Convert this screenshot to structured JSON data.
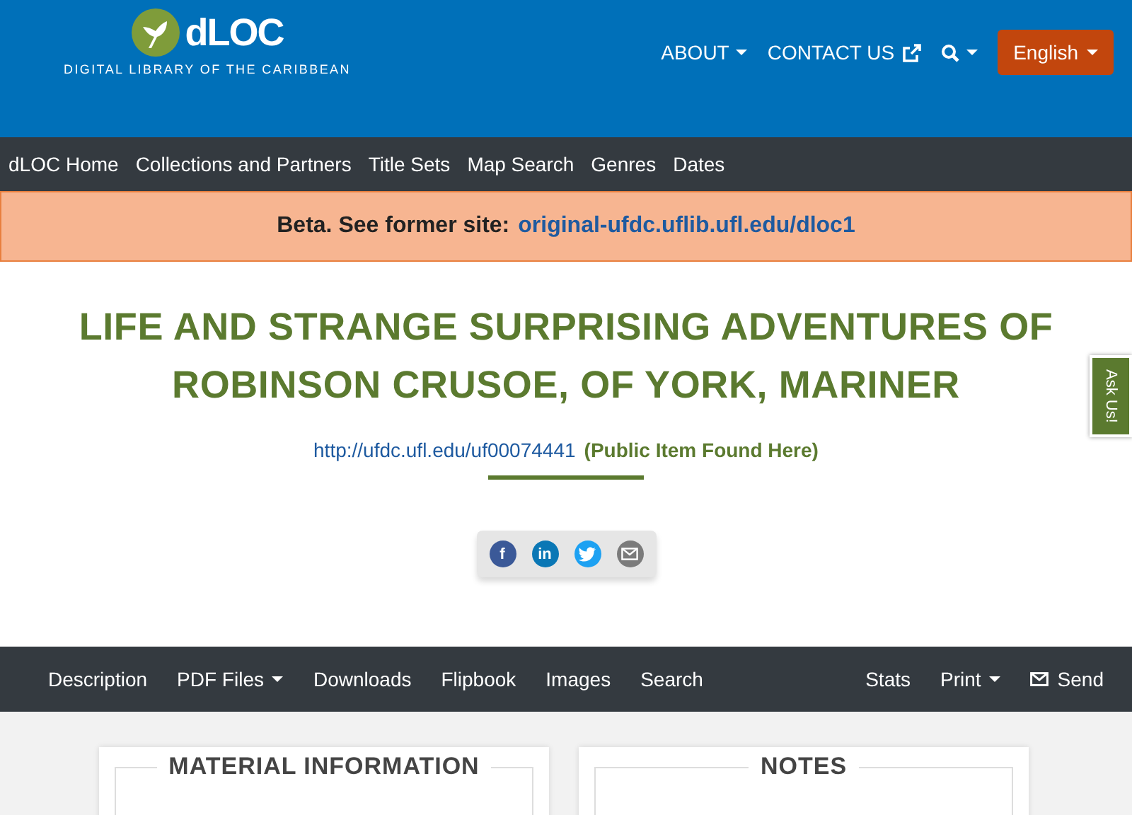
{
  "header": {
    "logo": {
      "name": "dLOC",
      "tagline": "DIGITAL LIBRARY OF THE CARIBBEAN"
    },
    "menu": [
      {
        "kind": "dropdown",
        "label": "ABOUT"
      },
      {
        "kind": "external",
        "label": "CONTACT US"
      },
      {
        "kind": "search"
      }
    ],
    "language": "English"
  },
  "main_nav": [
    "dLOC Home",
    "Collections and Partners",
    "Title Sets",
    "Map Search",
    "Genres",
    "Dates"
  ],
  "banner": {
    "text": "Beta. See former site:",
    "link": "original-ufdc.uflib.ufl.edu/dloc1"
  },
  "title": "LIFE AND STRANGE SURPRISING ADVENTURES OF ROBINSON CRUSOE, OF YORK, MARINER",
  "item_link": {
    "url": "http://ufdc.ufl.edu/uf00074441",
    "note": "(Public Item Found Here)"
  },
  "share": [
    {
      "kind": "facebook",
      "glyph": "f"
    },
    {
      "kind": "linkedin",
      "glyph": "in"
    },
    {
      "kind": "twitter"
    },
    {
      "kind": "email"
    }
  ],
  "side_tab": "Ask Us!",
  "item_nav": {
    "left": [
      {
        "label": "Description",
        "kind": "plain"
      },
      {
        "label": "PDF Files",
        "kind": "dropdown"
      },
      {
        "label": "Downloads",
        "kind": "plain"
      },
      {
        "label": "Flipbook",
        "kind": "plain"
      },
      {
        "label": "Images",
        "kind": "plain"
      },
      {
        "label": "Search",
        "kind": "plain"
      }
    ],
    "right": [
      {
        "label": "Stats",
        "kind": "plain"
      },
      {
        "label": "Print",
        "kind": "dropdown"
      },
      {
        "label": "Send",
        "kind": "send"
      }
    ]
  },
  "cards": [
    {
      "title": "MATERIAL INFORMATION"
    },
    {
      "title": "NOTES"
    }
  ]
}
